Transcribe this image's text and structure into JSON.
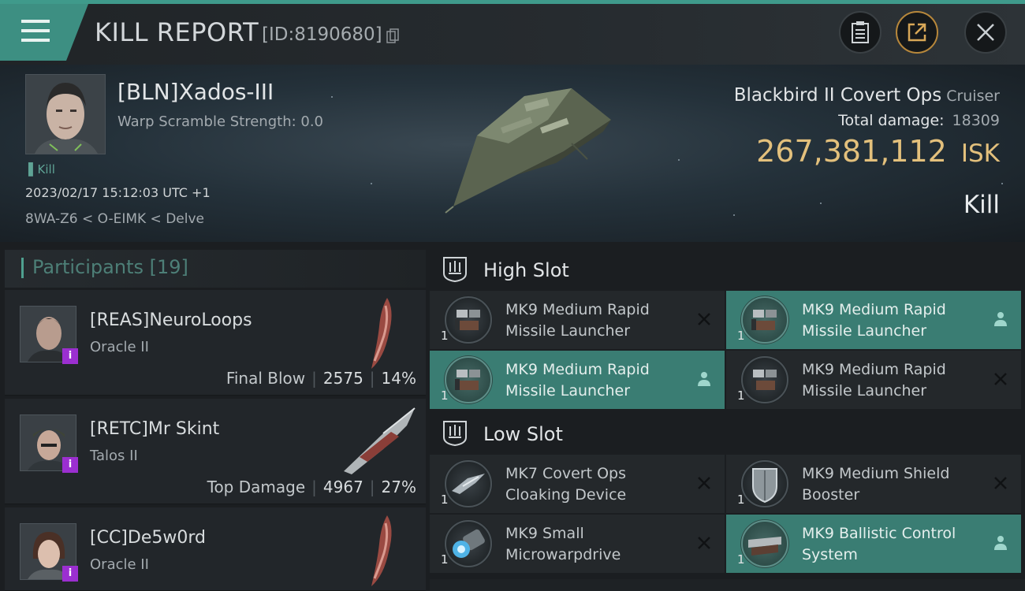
{
  "header": {
    "title": "KILL REPORT",
    "kill_id": "[ID:8190680]",
    "icons": {
      "menu": "hamburger-icon",
      "copy": "copy-icon",
      "clipboard": "clipboard-icon",
      "export": "external-link-icon",
      "close": "close-icon"
    }
  },
  "victim": {
    "name": "[BLN]Xados-III",
    "warp_scramble": "Warp Scramble Strength: 0.0",
    "kill_tag": "Kill",
    "date": "2023/02/17 15:12:03 UTC +1",
    "location": "8WA-Z6 < O-EIMK < Delve",
    "ship_name": "Blackbird II Covert Ops",
    "ship_class": "Cruiser",
    "total_damage_label": "Total damage:",
    "total_damage": "18309",
    "isk_value": "267,381,112",
    "isk_unit": "ISK",
    "result": "Kill"
  },
  "participants": {
    "title": "Participants [19]",
    "items": [
      {
        "name": "[REAS]NeuroLoops",
        "ship": "Oracle II",
        "role": "Final Blow",
        "damage": "2575",
        "percent": "14%"
      },
      {
        "name": "[RETC]Mr Skint",
        "ship": "Talos II",
        "role": "Top Damage",
        "damage": "4967",
        "percent": "27%"
      },
      {
        "name": "[CC]De5w0rd",
        "ship": "Oracle II",
        "role": "",
        "damage": "",
        "percent": ""
      }
    ]
  },
  "fitting": {
    "high_slot": {
      "label": "High Slot",
      "modules": [
        {
          "name": "MK9 Medium Rapid Missile Launcher",
          "qty": "1",
          "status": "destroyed"
        },
        {
          "name": "MK9 Medium Rapid Missile Launcher",
          "qty": "1",
          "status": "dropped"
        },
        {
          "name": "MK9 Medium Rapid Missile Launcher",
          "qty": "1",
          "status": "dropped"
        },
        {
          "name": "MK9 Medium Rapid Missile Launcher",
          "qty": "1",
          "status": "destroyed"
        }
      ]
    },
    "low_slot": {
      "label": "Low Slot",
      "modules": [
        {
          "name": "MK7 Covert Ops Cloaking Device",
          "qty": "1",
          "status": "destroyed"
        },
        {
          "name": "MK9 Medium Shield Booster",
          "qty": "1",
          "status": "destroyed"
        },
        {
          "name": "MK9 Small Microwarpdrive",
          "qty": "1",
          "status": "destroyed"
        },
        {
          "name": "MK9 Ballistic Control System",
          "qty": "1",
          "status": "dropped"
        }
      ]
    }
  },
  "colors": {
    "accent_teal": "#3d8f82",
    "isk_gold": "#e3c07c",
    "dropped_bg": "#3a7d73",
    "implant_badge": "#9b2fd0"
  }
}
